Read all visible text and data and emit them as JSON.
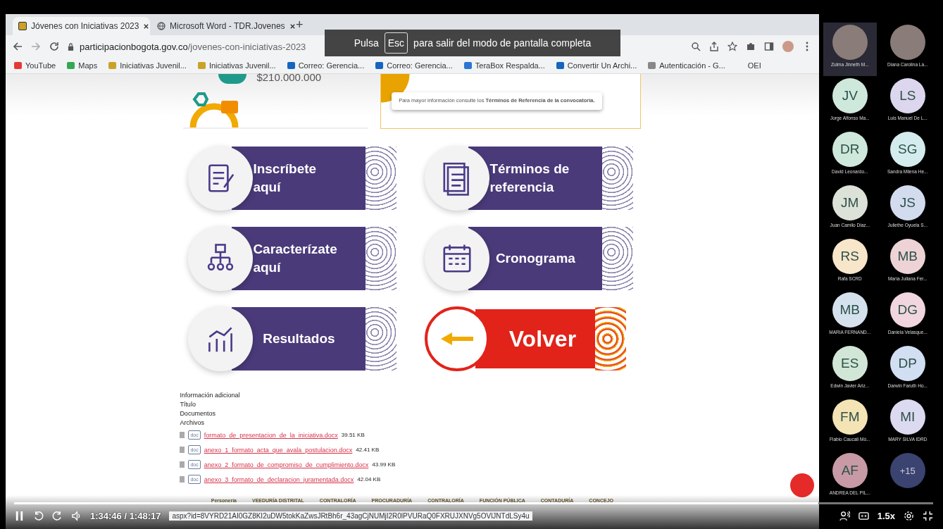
{
  "browser": {
    "tabs": [
      {
        "title": "Jóvenes con Iniciativas 2023",
        "selected": true
      },
      {
        "title": "Microsoft Word - TDR.Jovenes",
        "selected": false
      }
    ],
    "new_tab": "+",
    "address": {
      "domain": "participacionbogota.gov.co",
      "path": "/jovenes-con-iniciativas-2023"
    },
    "bookmarks": [
      "YouTube",
      "Maps",
      "Iniciativas Juvenil...",
      "Iniciativas Juvenil...",
      "Correo: Gerencia...",
      "Correo: Gerencia...",
      "TeraBox Respalda...",
      "Convertir Un Archi...",
      "Autenticación - G...",
      "OEI"
    ],
    "fullscreen_toast": {
      "before": "Pulsa",
      "key": "Esc",
      "after": "para salir del modo de pantalla completa"
    },
    "status_url": "aspx?id=8VYRD21AI0GZ8KI2uDW5tokKaZwsJRtBh6r_43agCjNUMjI2R0lPVURaQ0FXRUJXNVg5OVlJNTdLSy4u"
  },
  "page": {
    "amount": "$210.000.000",
    "note": "Para mayor información consulte los **Términos de Referencia de la convocatoria.**",
    "cards": [
      {
        "kind": "menu",
        "label": "Inscríbete aquí"
      },
      {
        "kind": "menu",
        "label": "Términos de referencia"
      },
      {
        "kind": "menu",
        "label": "Caracterízate aquí"
      },
      {
        "kind": "menu",
        "label": "Cronograma"
      },
      {
        "kind": "menu",
        "label": "Resultados"
      },
      {
        "kind": "back",
        "label": "Volver"
      }
    ],
    "info_labels": [
      "Información adicional",
      "Título",
      "Documentos",
      "Archivos"
    ],
    "files": [
      {
        "type": "doc",
        "name": "formato_de_presentacion_de_la_iniciativa.docx",
        "size": "39.51 KB"
      },
      {
        "type": "doc",
        "name": "anexo_1_formato_acta_que_avala_postulacion.docx",
        "size": "42.41 KB"
      },
      {
        "type": "doc",
        "name": "anexo_2_formato_de_compromiso_de_cumplimiento.docx",
        "size": "43.99 KB"
      },
      {
        "type": "doc",
        "name": "anexo_3_formato_de_declaracion_juramentada.docx",
        "size": "42.04 KB"
      }
    ],
    "logos": [
      "Personería",
      "VEEDURÍA DISTRITAL",
      "CONTRALORÍA",
      "PROCURADURÍA",
      "CONTRALORÍA",
      "FUNCIÓN PÚBLICA",
      "CONTADURÍA",
      "CONCEJO"
    ]
  },
  "participants": [
    {
      "kind": "photo",
      "name": "Zulma Jinneth M...",
      "selected": true
    },
    {
      "kind": "photo",
      "name": "Diana Carolina La...",
      "selected": false
    },
    {
      "kind": "initials",
      "initials": "JV",
      "name": "Jorge Alfonso Ma...",
      "color": "#cfe8dc",
      "selected": false
    },
    {
      "kind": "initials",
      "initials": "LS",
      "name": "Luis Manuel De L...",
      "color": "#dcd6ee",
      "selected": false
    },
    {
      "kind": "initials",
      "initials": "DR",
      "name": "David Leonardo...",
      "color": "#cfe8dc",
      "selected": false
    },
    {
      "kind": "initials",
      "initials": "SG",
      "name": "Sandra Milena He...",
      "color": "#d4ecee",
      "selected": false
    },
    {
      "kind": "initials",
      "initials": "JM",
      "name": "Juan Camilo Diaz...",
      "color": "#dde2d8",
      "selected": false
    },
    {
      "kind": "initials",
      "initials": "JS",
      "name": "Juliethe Oyuela S...",
      "color": "#d3dcef",
      "selected": false
    },
    {
      "kind": "initials",
      "initials": "RS",
      "name": "Rafa SCRD",
      "color": "#f7e6c9",
      "selected": false
    },
    {
      "kind": "initials",
      "initials": "MB",
      "name": "María Juliana Fer...",
      "color": "#edd3d6",
      "selected": false
    },
    {
      "kind": "initials",
      "initials": "MB",
      "name": "MARIA FERNAND...",
      "color": "#d5e2ee",
      "selected": false
    },
    {
      "kind": "initials",
      "initials": "DG",
      "name": "Daniela Velasque...",
      "color": "#f1d6df",
      "selected": false
    },
    {
      "kind": "initials",
      "initials": "ES",
      "name": "Edwin Javier Ariz...",
      "color": "#d2e6d8",
      "selected": false
    },
    {
      "kind": "initials",
      "initials": "DP",
      "name": "Darwin Faruth Ho...",
      "color": "#d2def2",
      "selected": false
    },
    {
      "kind": "initials",
      "initials": "FM",
      "name": "Flabio Caucali Mó...",
      "color": "#f4e3b5",
      "selected": false
    },
    {
      "kind": "initials",
      "initials": "MI",
      "name": "MARY SILVA IDRD",
      "color": "#dcdaf0",
      "selected": false
    },
    {
      "kind": "initials",
      "initials": "AF",
      "name": "ANDREA DEL PIL...",
      "color": "#c79aa6",
      "selected": false
    },
    {
      "kind": "more",
      "initials": "+15",
      "color": "#3b4370",
      "selected": false
    }
  ],
  "player": {
    "progress": {
      "level": 0.875
    },
    "time": "1:34:46 / 1:48:17",
    "speed": "1.5x"
  }
}
